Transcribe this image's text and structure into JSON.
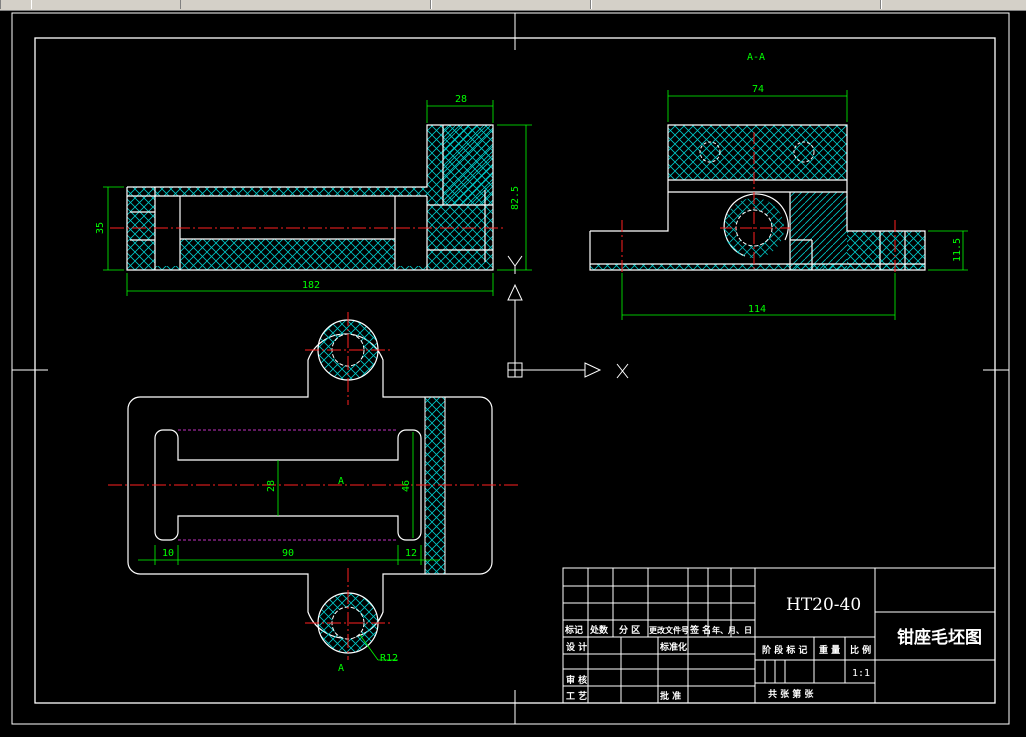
{
  "drawing": {
    "section_label": "A-A",
    "axis_x": "X",
    "axis_y": "Y",
    "section_mark_1": "A",
    "section_mark_2": "A",
    "dims": {
      "d28": "28",
      "d825": "82.5",
      "d35": "35",
      "d182": "182",
      "d74": "74",
      "d115": "11.5",
      "d114": "114",
      "d28v": "28",
      "d46": "46",
      "d10": "10",
      "d90": "90",
      "d12": "12",
      "r12": "R12"
    }
  },
  "title_block": {
    "material": "HT20-40",
    "drawing_name": "钳座毛坯图",
    "scale": "1:1",
    "labels": {
      "mark": "标记",
      "count": "处数",
      "zone": "分 区",
      "change_doc": "更改文件号",
      "signature": "签 名",
      "date": "年、月、日",
      "design": "设 计",
      "standardize": "标准化",
      "stage_mark": "阶 段 标 记",
      "weight": "重 量",
      "ratio": "比 例",
      "review": "审 核",
      "process": "工 艺",
      "approve": "批 准",
      "sheets": "共 张 第 张"
    }
  }
}
